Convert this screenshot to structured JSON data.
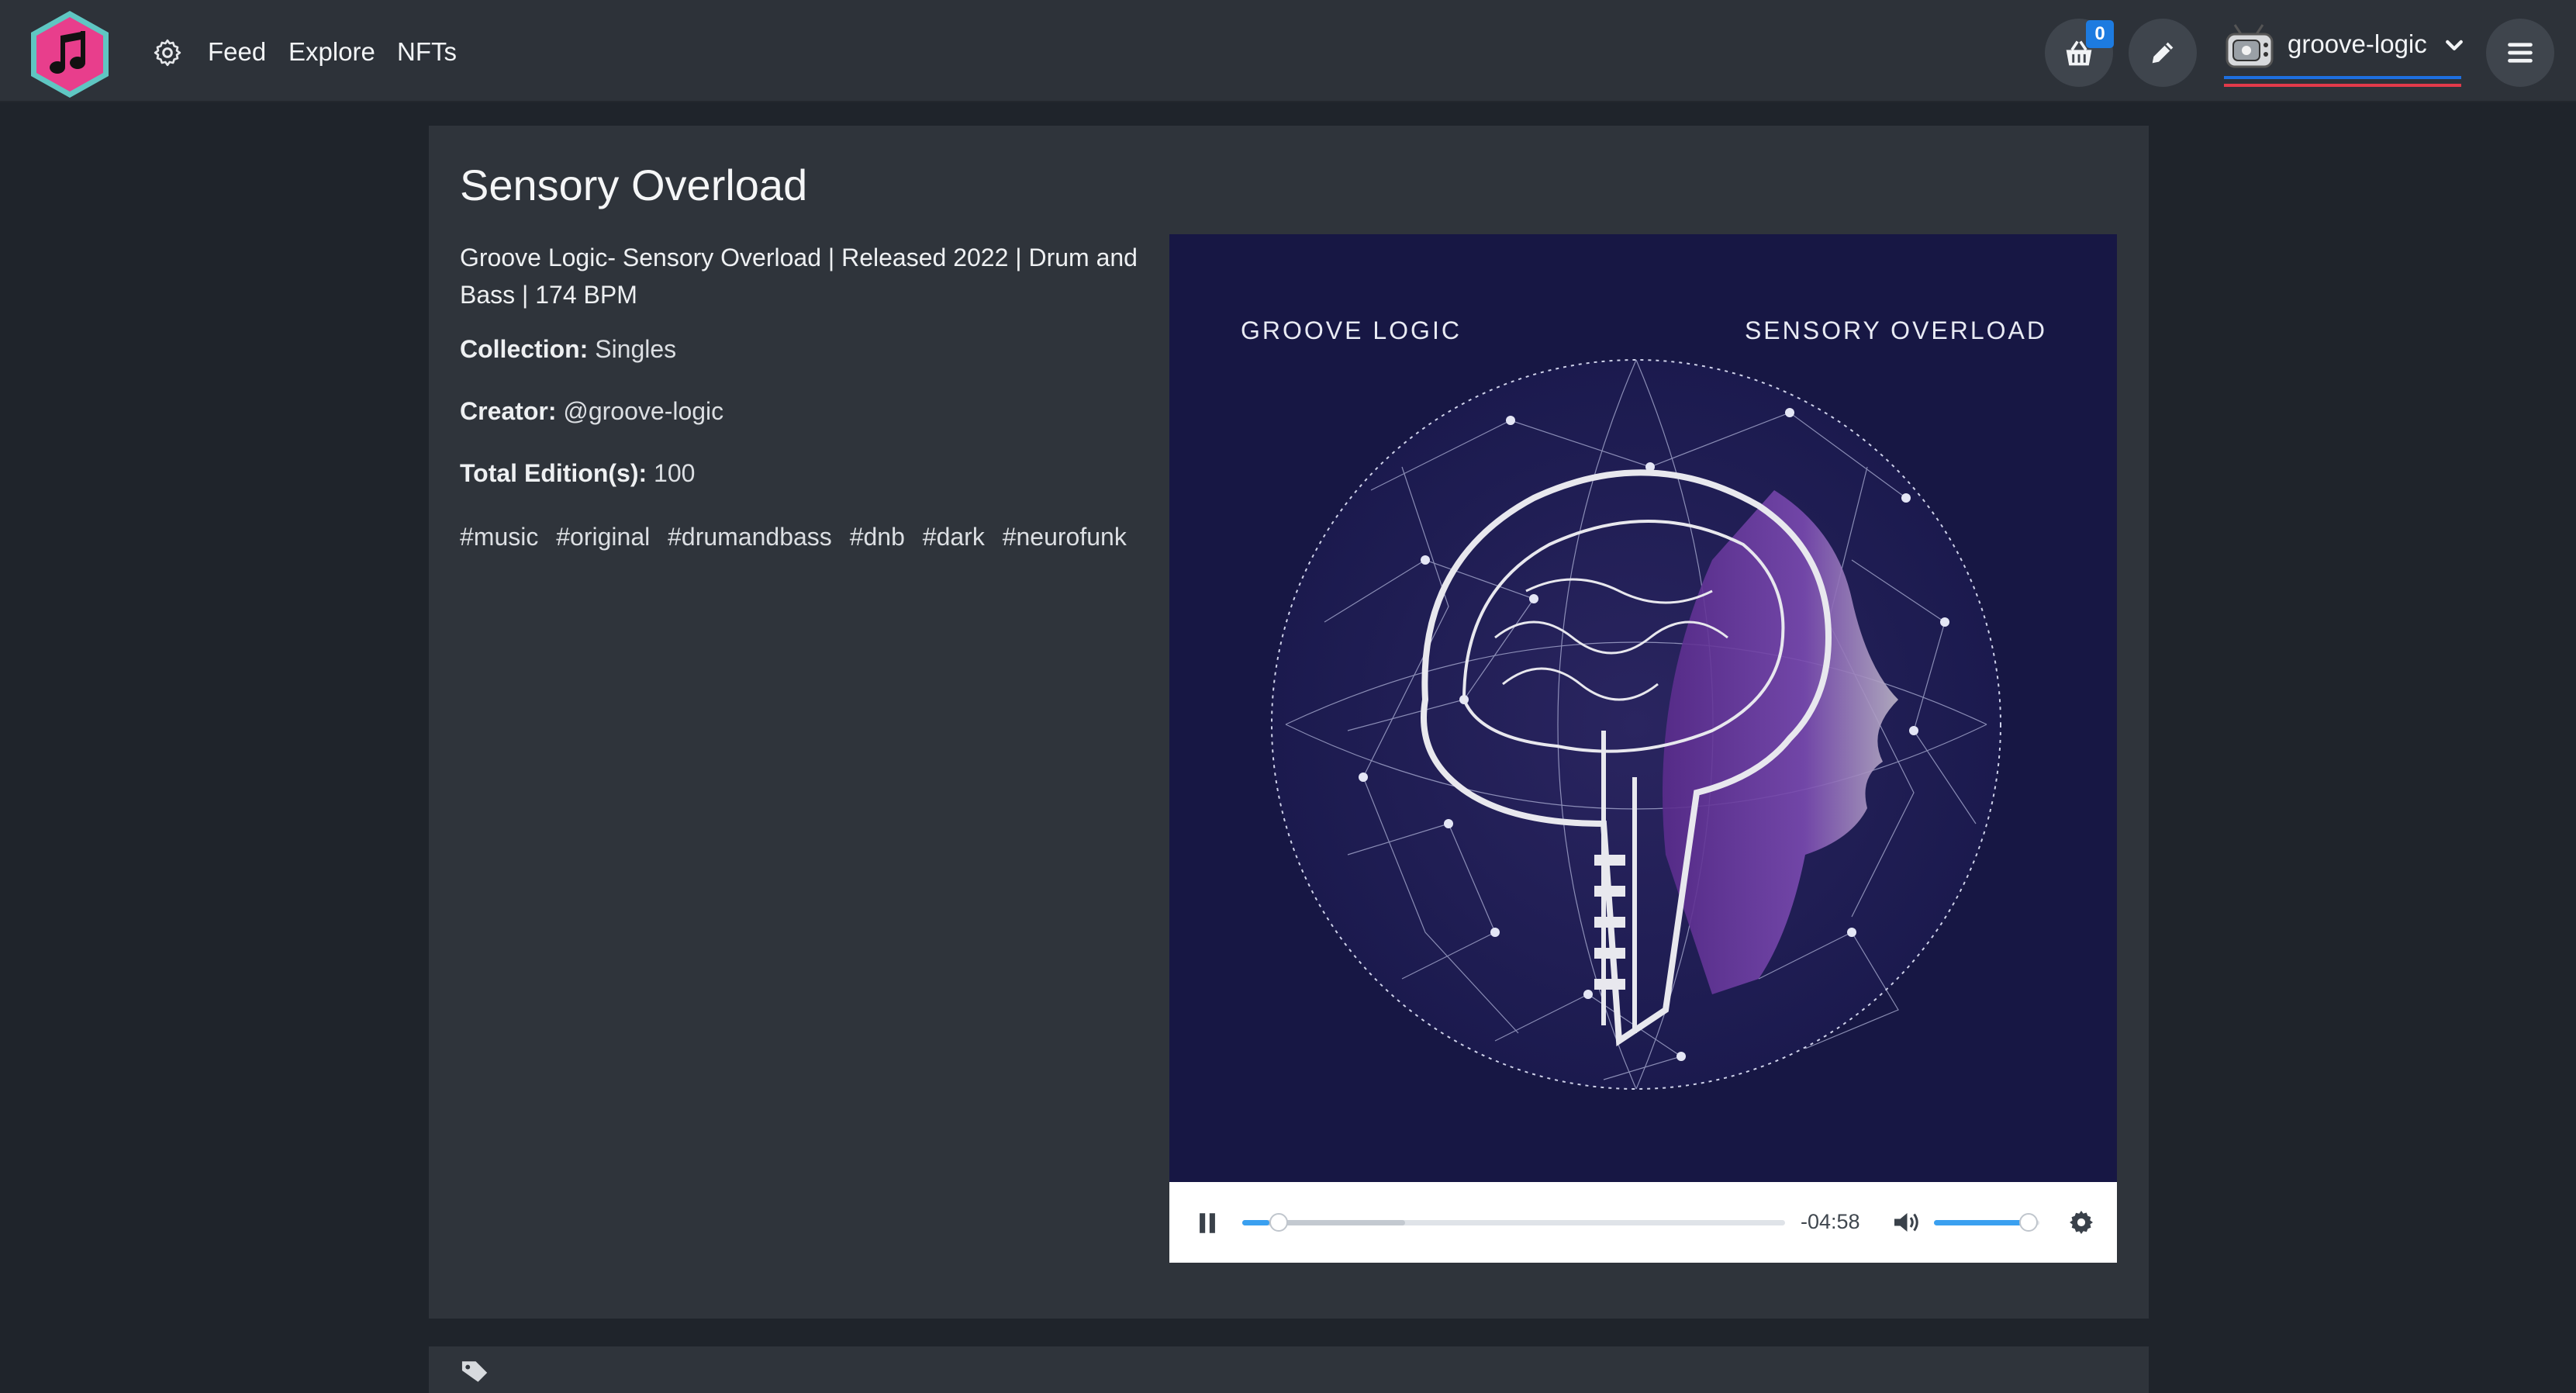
{
  "nav": {
    "links": [
      "Feed",
      "Explore",
      "NFTs"
    ],
    "cart_count": "0",
    "username": "groove-logic"
  },
  "icons": {
    "logo": "music-note-hexagon-logo",
    "settings": "gear-icon",
    "cart": "basket-icon",
    "edit": "pencil-icon",
    "menu": "hamburger-icon",
    "caret": "chevron-down-icon",
    "play": "pause-icon",
    "volume": "volume-icon",
    "player_settings": "gear-icon",
    "tags_section": "tags-icon"
  },
  "nft": {
    "title": "Sensory Overload",
    "description": "Groove Logic- Sensory Overload | Released 2022 | Drum and Bass | 174 BPM",
    "collection_label": "Collection:",
    "collection": "Singles",
    "creator_label": "Creator:",
    "creator": "@groove-logic",
    "editions_label": "Total Edition(s):",
    "editions": "100",
    "tags": [
      "#music",
      "#original",
      "#drumandbass",
      "#dnb",
      "#dark",
      "#neurofunk"
    ]
  },
  "cover": {
    "artist": "GROOVE LOGIC",
    "track": "SENSORY OVERLOAD"
  },
  "player": {
    "time_remaining": "-04:58",
    "progress": 0.05,
    "buffered": 0.3,
    "volume": 0.9
  },
  "colors": {
    "accent_pink": "#e83e8c",
    "accent_teal": "#5fc6c2",
    "badge_blue": "#1d7be0",
    "progress_blue": "#3aa0f0",
    "cover_bg": "#171744"
  }
}
